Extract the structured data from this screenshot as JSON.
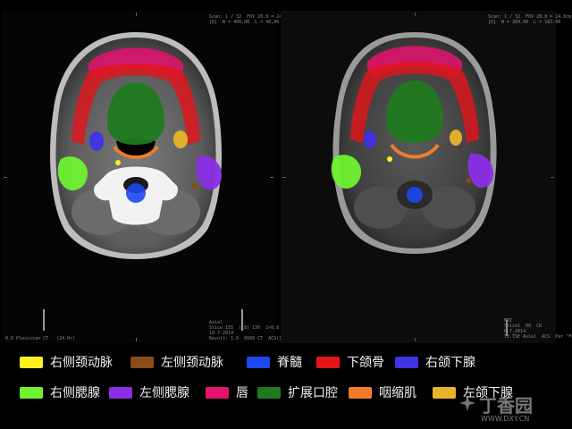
{
  "panels": {
    "ct": {
      "caption_top": "Scan: 1 / 32  FOV 20.8 = 24.8cm\n[D]  W = 400,00  L = 40,00",
      "caption_bottom_left": "0.0 Plexiscan CT   (24 Hr)",
      "caption_bottom_right": "Axial\nSlice 155  (18) 130  2×0.6 mm\n10-7-2014\nRevolt: 1.0  6000 CT  ACS(18)  FK  29:41"
    },
    "mr": {
      "caption_top": "Scan: 1 / 32  FOV 20.8 = 24.8cm\n[D]  W = 384.00  L = 183.00",
      "caption_bottom_right": "MRI\nSlice1  H0  CR\n6-7-2014\nT2 TSE Axial  ACS  Pat ^Fone(20)"
    }
  },
  "legend": [
    {
      "label": "右侧颈动脉",
      "color": "#ffef1e"
    },
    {
      "label": "左侧颈动脉",
      "color": "#8b4a17"
    },
    {
      "label": "脊髓",
      "color": "#1c48f0"
    },
    {
      "label": "下颌骨",
      "color": "#e4141a"
    },
    {
      "label": "右颌下腺",
      "color": "#3f33e6"
    },
    {
      "label": "右侧腮腺",
      "color": "#6ff230"
    },
    {
      "label": "左侧腮腺",
      "color": "#8b2ee6"
    },
    {
      "label": "唇",
      "color": "#e5126e"
    },
    {
      "label": "扩展口腔",
      "color": "#1f7a1f"
    },
    {
      "label": "咽缩肌",
      "color": "#f07c2b"
    },
    {
      "label": "左颌下腺",
      "color": "#e8b429"
    }
  ],
  "watermark": {
    "title": "丁香园",
    "url": "WWW.DXY.CN"
  }
}
